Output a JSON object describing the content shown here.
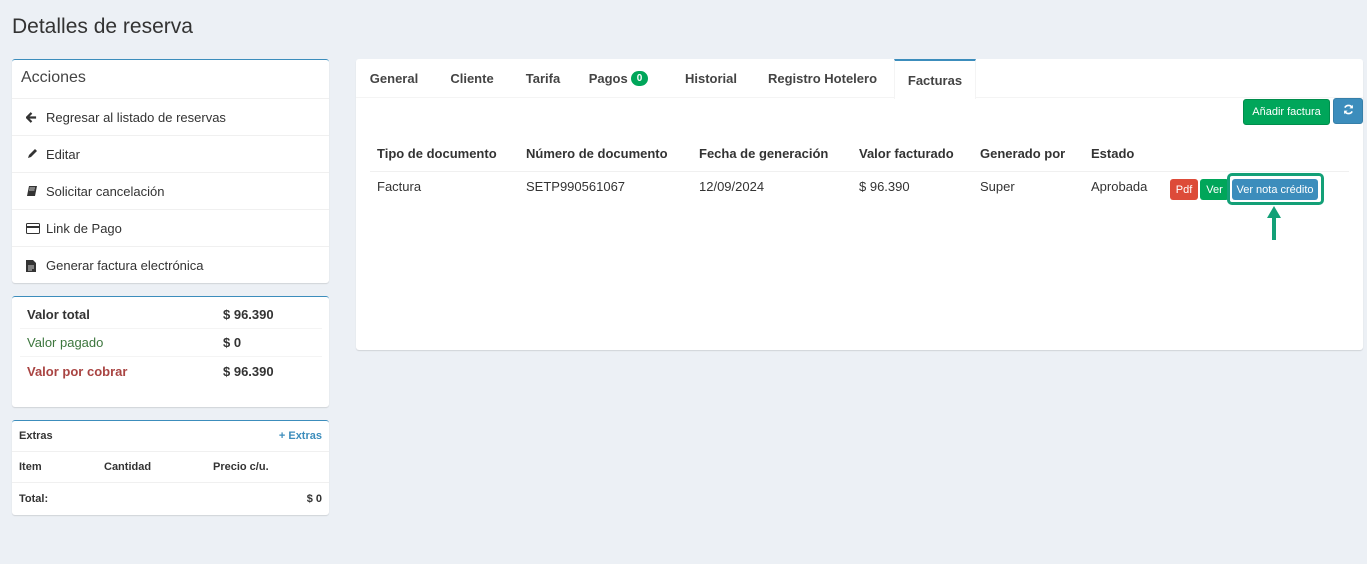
{
  "page": {
    "title": "Detalles de reserva"
  },
  "actions": {
    "title": "Acciones",
    "items": [
      {
        "label": "Regresar al listado de reservas",
        "icon": "arrow-left-icon"
      },
      {
        "label": "Editar",
        "icon": "pencil-icon"
      },
      {
        "label": "Solicitar cancelación",
        "icon": "book-icon"
      },
      {
        "label": "Link de Pago",
        "icon": "credit-card-icon"
      },
      {
        "label": "Generar factura electrónica",
        "icon": "file-text-icon"
      }
    ]
  },
  "values": {
    "total": {
      "label": "Valor total",
      "amount": "$ 96.390",
      "color": "#333333"
    },
    "paid": {
      "label": "Valor pagado",
      "amount": "$ 0",
      "color": "#3c763d"
    },
    "due": {
      "label": "Valor por cobrar",
      "amount": "$ 96.390",
      "color": "#a94442"
    }
  },
  "extras": {
    "title": "Extras",
    "add_link": "+ Extras",
    "columns": [
      "Item",
      "Cantidad",
      "Precio c/u."
    ],
    "total_label": "Total:",
    "total_value": "$ 0"
  },
  "tabs": [
    {
      "label": "General"
    },
    {
      "label": "Cliente"
    },
    {
      "label": "Tarifa"
    },
    {
      "label": "Pagos",
      "badge": "0"
    },
    {
      "label": "Historial"
    },
    {
      "label": "Registro Hotelero"
    },
    {
      "label": "Facturas",
      "active": true
    }
  ],
  "toolbar": {
    "add_invoice": "Añadir factura",
    "refresh_icon": "refresh-icon"
  },
  "invoices": {
    "columns": [
      "Tipo de documento",
      "Número de documento",
      "Fecha de generación",
      "Valor facturado",
      "Generado por",
      "Estado"
    ],
    "rows": [
      {
        "type": "Factura",
        "number": "SETP990561067",
        "date": "12/09/2024",
        "amount": "$ 96.390",
        "by": "Super",
        "status": "Aprobada",
        "actions": {
          "pdf": "Pdf",
          "view": "Ver",
          "credit_note": "Ver nota crédito"
        }
      }
    ]
  },
  "colors": {
    "accent": "#3c8dbc",
    "success": "#00a65a",
    "danger": "#dd4b39",
    "highlight": "#13a077"
  }
}
